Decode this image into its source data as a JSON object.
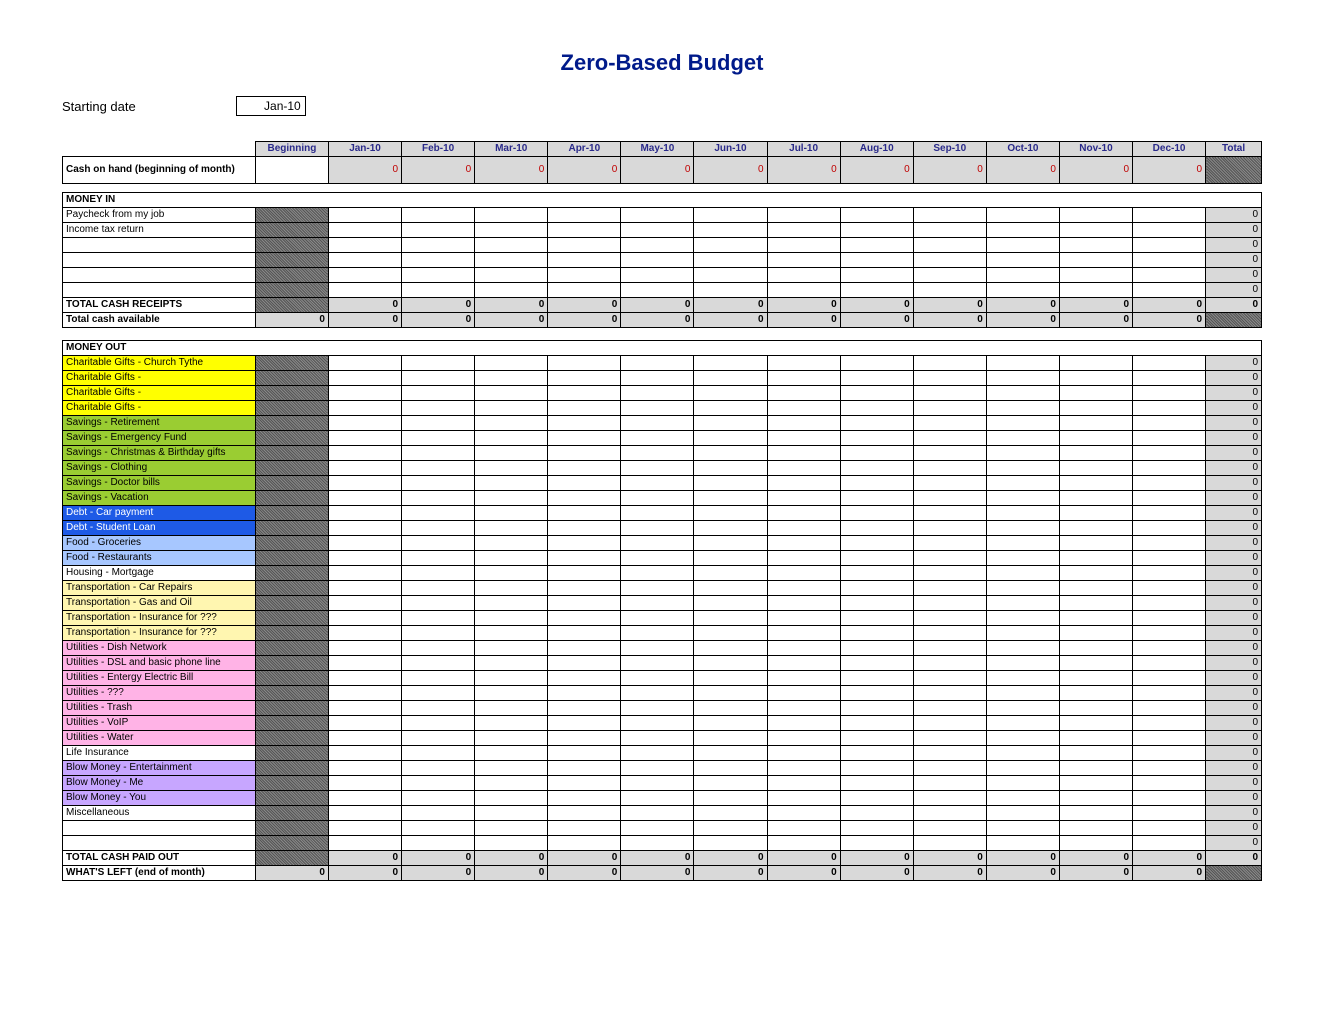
{
  "title": "Zero-Based Budget",
  "starting_date_label": "Starting date",
  "starting_date_value": "Jan-10",
  "columns": [
    "Beginning",
    "Jan-10",
    "Feb-10",
    "Mar-10",
    "Apr-10",
    "May-10",
    "Jun-10",
    "Jul-10",
    "Aug-10",
    "Sep-10",
    "Oct-10",
    "Nov-10",
    "Dec-10",
    "Total"
  ],
  "cash_on_hand": {
    "label": "Cash on hand (beginning of month)",
    "month_value": "0"
  },
  "money_in_heading": "MONEY IN",
  "money_in_rows": [
    "Paycheck from my job",
    "Income tax return",
    "",
    "",
    "",
    ""
  ],
  "total_receipts_label": "TOTAL CASH RECEIPTS",
  "total_cash_available_label": "Total cash available",
  "zero": "0",
  "money_out_heading": "MONEY OUT",
  "money_out_rows": [
    {
      "label": "Charitable Gifts - Church Tythe",
      "color": "c-yellow"
    },
    {
      "label": "Charitable Gifts -",
      "color": "c-yellow"
    },
    {
      "label": "Charitable Gifts -",
      "color": "c-yellow"
    },
    {
      "label": "Charitable Gifts -",
      "color": "c-yellow"
    },
    {
      "label": "Savings - Retirement",
      "color": "c-green"
    },
    {
      "label": "Savings - Emergency Fund",
      "color": "c-green"
    },
    {
      "label": "Savings - Christmas & Birthday gifts",
      "color": "c-green"
    },
    {
      "label": "Savings - Clothing",
      "color": "c-green"
    },
    {
      "label": "Savings - Doctor bills",
      "color": "c-green"
    },
    {
      "label": "Savings - Vacation",
      "color": "c-green"
    },
    {
      "label": "Debt - Car payment",
      "color": "c-blue"
    },
    {
      "label": "Debt - Student Loan",
      "color": "c-blue"
    },
    {
      "label": "Food - Groceries",
      "color": "c-lblue"
    },
    {
      "label": "Food - Restaurants",
      "color": "c-lblue"
    },
    {
      "label": "Housing - Mortgage",
      "color": "c-white"
    },
    {
      "label": "Transportation - Car Repairs",
      "color": "c-lyellow"
    },
    {
      "label": "Transportation - Gas and Oil",
      "color": "c-lyellow"
    },
    {
      "label": "Transportation - Insurance for ???",
      "color": "c-lyellow"
    },
    {
      "label": "Transportation - Insurance for ???",
      "color": "c-lyellow"
    },
    {
      "label": "Utilities - Dish Network",
      "color": "c-pink"
    },
    {
      "label": "Utilities - DSL and basic phone line",
      "color": "c-pink"
    },
    {
      "label": "Utilities - Entergy Electric Bill",
      "color": "c-pink"
    },
    {
      "label": "Utilities - ???",
      "color": "c-pink"
    },
    {
      "label": "Utilities - Trash",
      "color": "c-pink"
    },
    {
      "label": "Utilities - VoIP",
      "color": "c-pink"
    },
    {
      "label": "Utilities - Water",
      "color": "c-pink"
    },
    {
      "label": "Life Insurance",
      "color": "c-white"
    },
    {
      "label": "Blow Money - Entertainment",
      "color": "c-purple"
    },
    {
      "label": "Blow Money - Me",
      "color": "c-purple"
    },
    {
      "label": "Blow Money - You",
      "color": "c-purple"
    },
    {
      "label": "Miscellaneous",
      "color": "c-white"
    },
    {
      "label": "",
      "color": "c-white"
    },
    {
      "label": "",
      "color": "c-white"
    }
  ],
  "total_paid_out_label": "TOTAL CASH PAID OUT",
  "whats_left_label": "WHAT'S LEFT (end of month)"
}
